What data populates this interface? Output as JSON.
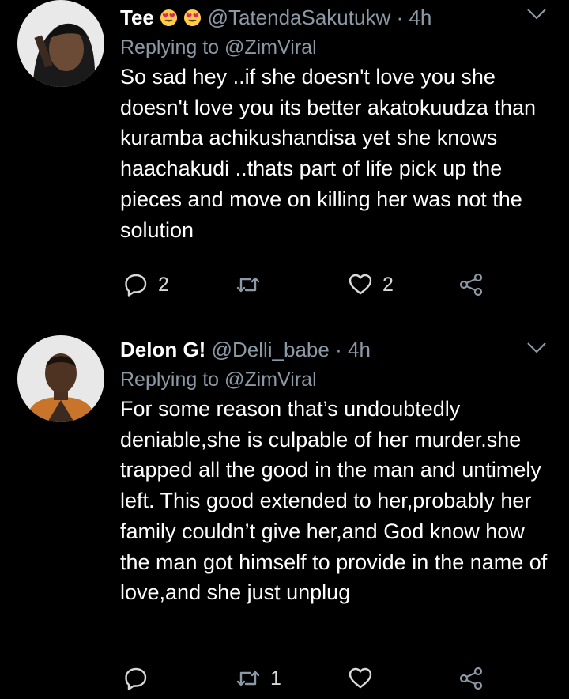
{
  "tweets": [
    {
      "display_name": "Tee",
      "emojis": [
        "heart-eyes",
        "heart-eyes"
      ],
      "handle": "@TatendaSakutukw",
      "separator": "·",
      "time": "4h",
      "replying_prefix": "Replying to",
      "replying_to": "@ZimViral",
      "text": "So sad hey ..if she doesn't love you she doesn't love you its better akatokuudza than kuramba achikushandisa yet she knows haachakudi ..thats part of life pick up the pieces and move on killing her was not the solution",
      "reply_count": "2",
      "retweet_count": "",
      "like_count": "2"
    },
    {
      "display_name": "Delon G!",
      "emojis": [],
      "handle": "@Delli_babe",
      "separator": "·",
      "time": "4h",
      "replying_prefix": "Replying to",
      "replying_to": "@ZimViral",
      "text": "For some reason that’s undoubtedly deniable,she is culpable of her murder.she trapped all the good in the man and untimely left. This good extended to her,probably her family couldn’t give her,and God know how the man got himself to provide in the name of love,and she just unplug",
      "reply_count": "",
      "retweet_count": "1",
      "like_count": ""
    }
  ],
  "colors": {
    "background": "#000000",
    "text": "#ffffff",
    "secondary": "#8b98a5",
    "divider": "#2f3336"
  },
  "icons": [
    "reply-icon",
    "retweet-icon",
    "like-icon",
    "share-icon",
    "chevron-down-icon"
  ]
}
